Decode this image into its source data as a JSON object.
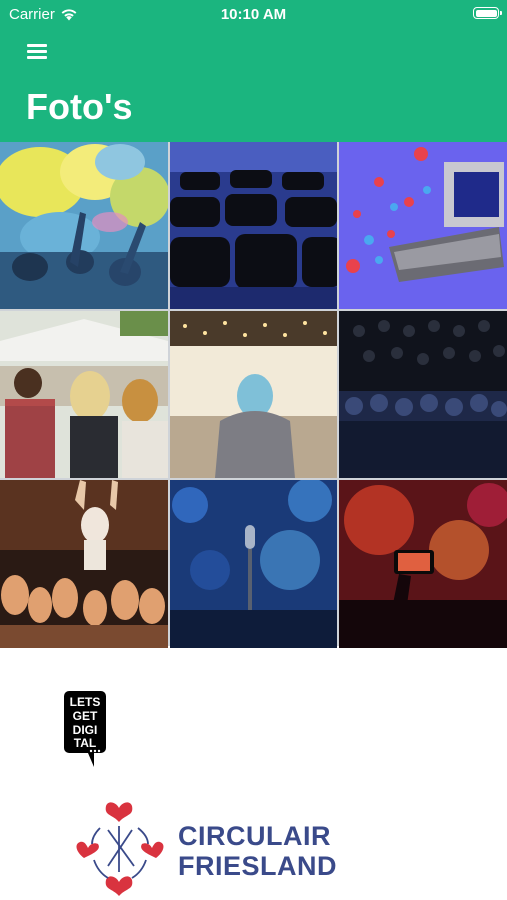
{
  "status_bar": {
    "carrier": "Carrier",
    "time": "10:10 AM"
  },
  "header": {
    "title": "Foto's",
    "background": "#1bb57f"
  },
  "photos": [
    {
      "name": "color-festival"
    },
    {
      "name": "empty-chairs"
    },
    {
      "name": "livestream-stage"
    },
    {
      "name": "outdoor-festival"
    },
    {
      "name": "conference-hall"
    },
    {
      "name": "audience-dark"
    },
    {
      "name": "crowd-hands"
    },
    {
      "name": "microphone-stage"
    },
    {
      "name": "phone-concert"
    }
  ],
  "logos": {
    "lets_get_digital": "LETS GET DIGITAL",
    "circulair": {
      "line1": "CIRCULAIR",
      "line2": "FRIESLAND",
      "text_color": "#3a4a8a",
      "heart_color": "#d9333f"
    }
  }
}
